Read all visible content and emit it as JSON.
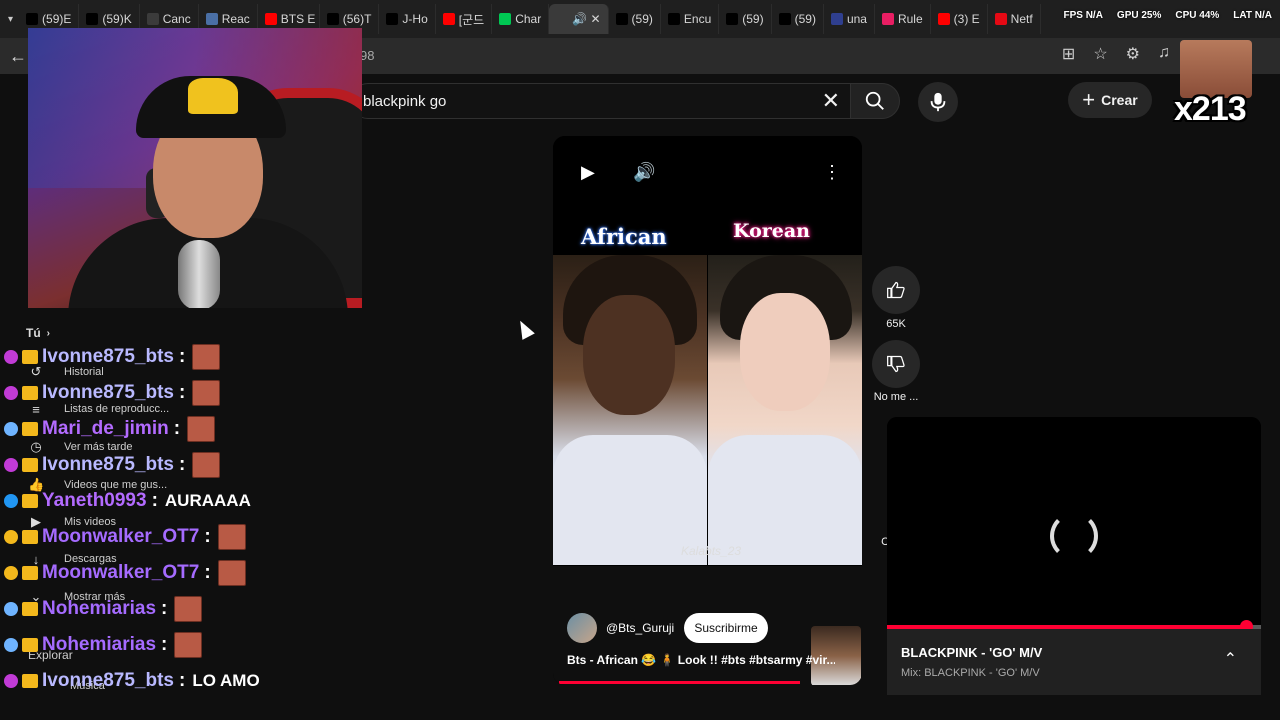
{
  "browser": {
    "tabs": [
      {
        "label": "(59)E",
        "color": "#000000"
      },
      {
        "label": "(59)K",
        "color": "#000000"
      },
      {
        "label": "Canc",
        "color": "#3b3b3b"
      },
      {
        "label": "Reac",
        "color": "#4a6fa5"
      },
      {
        "label": "BTS E",
        "color": "#ff0000"
      },
      {
        "label": "(56)T",
        "color": "#000000"
      },
      {
        "label": "J-Ho",
        "color": "#000000"
      },
      {
        "label": "[군드",
        "color": "#ff0000"
      },
      {
        "label": "Char",
        "color": "#00c853"
      },
      {
        "label": "",
        "color": "#3a3a3a",
        "active": true
      },
      {
        "label": "(59)",
        "color": "#000000"
      },
      {
        "label": "Encu",
        "color": "#000000"
      },
      {
        "label": "(59)",
        "color": "#000000"
      },
      {
        "label": "(59)",
        "color": "#000000"
      },
      {
        "label": "una",
        "color": "#2f3f8f"
      },
      {
        "label": "Rule",
        "color": "#e91e63"
      },
      {
        "label": "(3) E",
        "color": "#ff0000"
      },
      {
        "label": "Netf",
        "color": "#e50914"
      }
    ],
    "url_fragment": "98"
  },
  "stats": {
    "fps": "FPS N/A",
    "gpu": "GPU 25%",
    "cpu": "CPU 44%",
    "lat": "LAT N/A"
  },
  "youtube": {
    "search": {
      "query": "blackpink go"
    },
    "create_label": "Crear"
  },
  "gif_counter": "x213",
  "sidebar": {
    "you_label": "Tú",
    "items": [
      {
        "label": "Historial",
        "icon": "history-icon"
      },
      {
        "label": "Listas de reproducc...",
        "icon": "playlist-icon"
      },
      {
        "label": "Ver más tarde",
        "icon": "clock-icon"
      },
      {
        "label": "Videos que me gus...",
        "icon": "thumbs-up-icon"
      },
      {
        "label": "Mis videos",
        "icon": "video-icon"
      },
      {
        "label": "Descargas",
        "icon": "download-icon"
      },
      {
        "label": "Mostrar más",
        "icon": "chevron-down-icon"
      }
    ],
    "explore_label": "Explorar",
    "music_label": "Música"
  },
  "chat": [
    {
      "user": "Ivonne875_bts",
      "color": "#b9b9ff",
      "message": "",
      "emote": true,
      "badge": "#c13bd6"
    },
    {
      "user": "Ivonne875_bts",
      "color": "#b9b9ff",
      "message": "",
      "emote": true,
      "badge": "#c13bd6"
    },
    {
      "user": "Mari_de_jimin",
      "color": "#b36bff",
      "message": "",
      "emote": true,
      "badge": "#6fb4ff"
    },
    {
      "user": "Ivonne875_bts",
      "color": "#b9b9ff",
      "message": "",
      "emote": true,
      "badge": "#c13bd6"
    },
    {
      "user": "Yaneth0993",
      "color": "#b36bff",
      "message": "AURAAAA",
      "emote": false,
      "badge": "#2196f3"
    },
    {
      "user": "Moonwalker_OT7",
      "color": "#a56bff",
      "message": "",
      "emote": true,
      "badge": "#f3b81c"
    },
    {
      "user": "Moonwalker_OT7",
      "color": "#a56bff",
      "message": "",
      "emote": true,
      "badge": "#f3b81c"
    },
    {
      "user": "Nohemiarias",
      "color": "#a56bff",
      "message": "",
      "emote": true,
      "badge": "#6fb4ff"
    },
    {
      "user": "Nohemiarias",
      "color": "#a56bff",
      "message": "",
      "emote": true,
      "badge": "#6fb4ff"
    },
    {
      "user": "Ivonne875_bts",
      "color": "#b9b9ff",
      "message": "LO AMO",
      "emote": false,
      "badge": "#c13bd6"
    }
  ],
  "short": {
    "label_left": "African",
    "label_right": "Korean",
    "watermark": "Kalabts_23",
    "channel": "@Bts_Guruji",
    "subscribe": "Suscribirme",
    "title": "Bts - African 😂 🧍 Look !! #bts #btsarmy #vir...",
    "progress": 0.78,
    "likes": "65K",
    "dislike_label": "No me ...",
    "comments_label": "Cor"
  },
  "mini_player": {
    "title": "BLACKPINK - 'GO' M/V",
    "subtitle": "Mix: BLACKPINK - 'GO' M/V",
    "progress": 0.96
  }
}
